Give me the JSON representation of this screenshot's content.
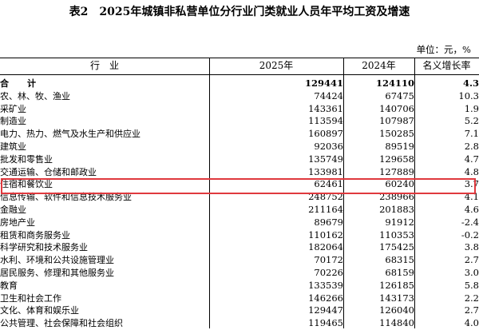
{
  "title": {
    "label": "表2",
    "text": "2025年城镇非私营单位分行业门类就业人员年平均工资及增速"
  },
  "unit": "单位：元，%",
  "columns": {
    "industry": "行　业",
    "y2025": "2025年",
    "y2024": "2024年",
    "growth": "名义增长率"
  },
  "rows": [
    {
      "name": "合　计",
      "v2025": "129441",
      "v2024": "124110",
      "growth": "4.3"
    },
    {
      "name": "农、林、牧、渔业",
      "v2025": "74424",
      "v2024": "67475",
      "growth": "10.3"
    },
    {
      "name": "采矿业",
      "v2025": "143361",
      "v2024": "140706",
      "growth": "1.9"
    },
    {
      "name": "制造业",
      "v2025": "113594",
      "v2024": "107987",
      "growth": "5.2"
    },
    {
      "name": "电力、热力、燃气及水生产和供应业",
      "v2025": "160897",
      "v2024": "150285",
      "growth": "7.1"
    },
    {
      "name": "建筑业",
      "v2025": "92036",
      "v2024": "89519",
      "growth": "2.8"
    },
    {
      "name": "批发和零售业",
      "v2025": "135749",
      "v2024": "129658",
      "growth": "4.7"
    },
    {
      "name": "交通运输、仓储和邮政业",
      "v2025": "133981",
      "v2024": "127889",
      "growth": "4.8"
    },
    {
      "name": "住宿和餐饮业",
      "v2025": "62461",
      "v2024": "60240",
      "growth": "3.7"
    },
    {
      "name": "信息传输、软件和信息技术服务业",
      "v2025": "248752",
      "v2024": "238966",
      "growth": "4.1"
    },
    {
      "name": "金融业",
      "v2025": "211164",
      "v2024": "201883",
      "growth": "4.6"
    },
    {
      "name": "房地产业",
      "v2025": "89679",
      "v2024": "91912",
      "growth": "-2.4"
    },
    {
      "name": "租赁和商务服务业",
      "v2025": "110162",
      "v2024": "110353",
      "growth": "-0.2"
    },
    {
      "name": "科学研究和技术服务业",
      "v2025": "182064",
      "v2024": "175425",
      "growth": "3.8"
    },
    {
      "name": "水利、环境和公共设施管理业",
      "v2025": "70172",
      "v2024": "68315",
      "growth": "2.7"
    },
    {
      "name": "居民服务、修理和其他服务业",
      "v2025": "70226",
      "v2024": "68159",
      "growth": "3.0"
    },
    {
      "name": "教育",
      "v2025": "133539",
      "v2024": "126185",
      "growth": "5.8"
    },
    {
      "name": "卫生和社会工作",
      "v2025": "146266",
      "v2024": "143173",
      "growth": "2.2"
    },
    {
      "name": "文化、体育和娱乐业",
      "v2025": "129447",
      "v2024": "126040",
      "growth": "2.7"
    },
    {
      "name": "公共管理、社会保障和社会组织",
      "v2025": "119465",
      "v2024": "114840",
      "growth": "4.0"
    }
  ],
  "highlight": {
    "row": "住宿和餐饮业",
    "color": "#e0393e"
  }
}
